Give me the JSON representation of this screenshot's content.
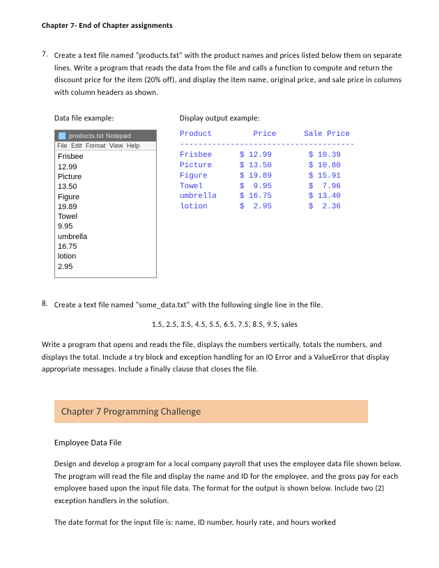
{
  "title": "Chapter 7- End of Chapter assignments",
  "q7": {
    "num": "7.",
    "text": "Create a text file named \"products.txt\" with the product names and prices listed below them on separate lines. Write a program that reads the data from the file and calls a function to compute and return the discount price for the item (20% off), and display the item name, original price, and sale price in columns with column headers as shown.",
    "data_label": "Data file example:",
    "output_label": "Display output example:",
    "notepad": {
      "title": "products.txt   Notepad",
      "menu": "File  Edit  Format  View  Help",
      "lines": [
        "Frisbee",
        "12.99",
        "Picture",
        "13.50",
        "Figure",
        "19.89",
        "Towel",
        "9.95",
        "umbrella",
        "16.75",
        "lotion",
        "2.95"
      ]
    },
    "output_header": "Product         Price      Sale Price",
    "output_divider": "--------------------------------------",
    "output_rows": [
      "Frisbee      $ 12.99        $ 10.39",
      "Picture      $ 13.50        $ 10.80",
      "Figure       $ 19.89        $ 15.91",
      "Towel        $  9.95        $  7.96",
      "umbrella     $ 16.75        $ 13.40",
      "lotion       $  2.95        $  2.36"
    ]
  },
  "q8": {
    "num": "8.",
    "line1": "Create a text file named \"some_data.txt\" with the following single line in the file.",
    "data": "1.5, 2.5, 3.5, 4.5, 5.5, 6.5, 7.5, 8.5, 9.5, sales",
    "line2": "Write a program that opens and reads the file, displays the numbers vertically, totals the numbers, and displays the total.  Include a try block and exception handling for an IO Error and a ValueError that display appropriate messages. Include a finally clause that closes the file."
  },
  "challenge": {
    "banner": "Chapter 7 Programming Challenge",
    "heading": "Employee Data File",
    "p1": "Design and develop a program for a local company payroll that uses the employee data file shown below. The program will read the file and display the name and ID for the employee, and the gross pay for each employee based upon the input file data. The format for the output is shown below. Include two (2) exception handlers in the solution.",
    "p2": "The date format for the input file is: name, ID number, hourly rate, and hours worked"
  }
}
